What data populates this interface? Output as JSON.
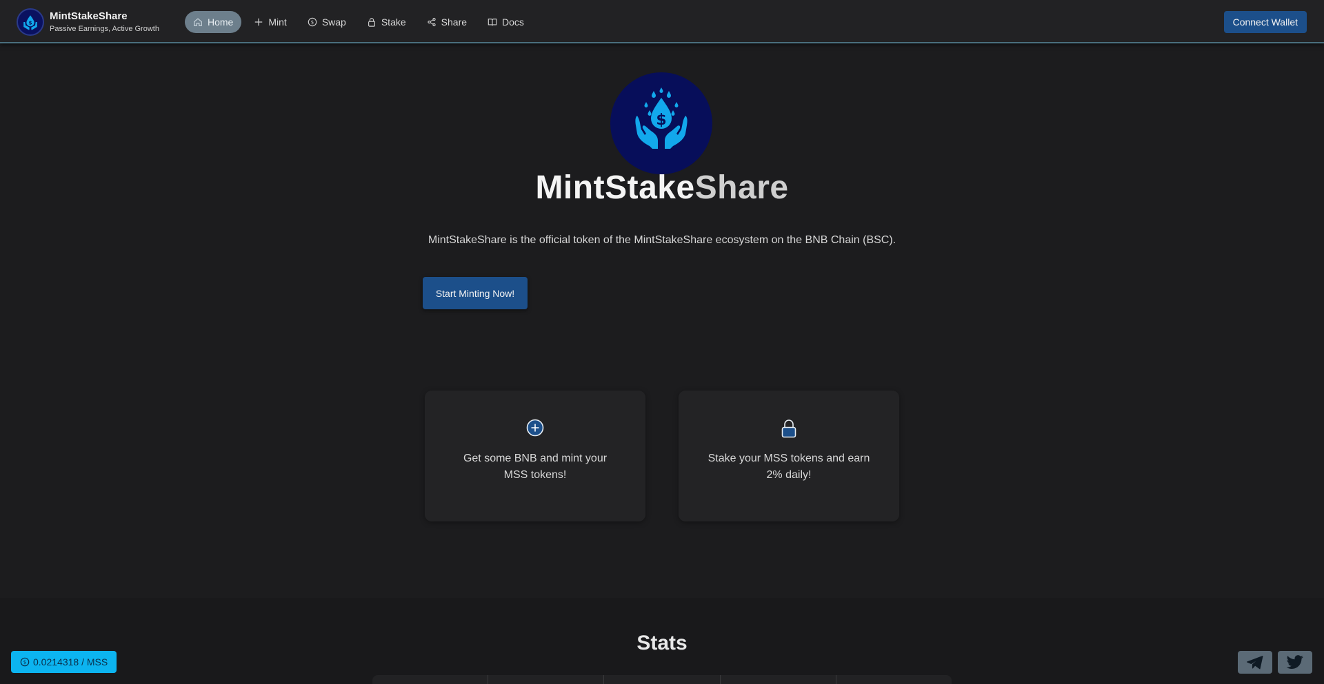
{
  "header": {
    "brand_name": "MintStakeShare",
    "brand_tagline": "Passive Earnings, Active Growth",
    "nav": [
      {
        "label": "Home",
        "icon": "home-icon",
        "active": true
      },
      {
        "label": "Mint",
        "icon": "plus-icon",
        "active": false
      },
      {
        "label": "Swap",
        "icon": "dollar-coin-icon",
        "active": false
      },
      {
        "label": "Stake",
        "icon": "lock-icon",
        "active": false
      },
      {
        "label": "Share",
        "icon": "share-icon",
        "active": false
      },
      {
        "label": "Docs",
        "icon": "book-icon",
        "active": false
      }
    ],
    "connect_label": "Connect Wallet"
  },
  "hero": {
    "title_part1": "MintStake",
    "title_part2": "Share",
    "description": "MintStakeShare is the official token of the MintStakeShare ecosystem on the BNB Chain (BSC).",
    "cta_label": "Start Minting Now!"
  },
  "features": [
    {
      "icon": "plus-circle-icon",
      "text": "Get some BNB and mint your MSS tokens!"
    },
    {
      "icon": "lock-icon",
      "text": "Stake your MSS tokens and earn 2% daily!"
    }
  ],
  "stats": {
    "title": "Stats"
  },
  "price_badge": {
    "icon": "dollar-coin-icon",
    "text": "0.0214318 / MSS"
  },
  "social": [
    {
      "icon": "telegram-icon"
    },
    {
      "icon": "twitter-icon"
    }
  ],
  "colors": {
    "accent": "#1c4f8a",
    "price_badge": "#0cb4f0",
    "logo_blue": "#12a8ec",
    "logo_bg": "#070e5a"
  }
}
